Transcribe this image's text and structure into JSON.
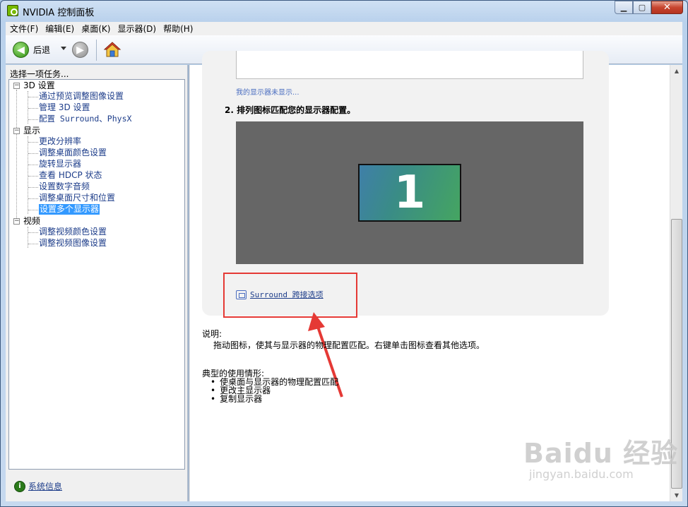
{
  "window": {
    "title": "NVIDIA 控制面板"
  },
  "menubar": [
    "文件(F)",
    "编辑(E)",
    "桌面(K)",
    "显示器(D)",
    "帮助(H)"
  ],
  "toolbar": {
    "back_label": "后退"
  },
  "left": {
    "header": "选择一项任务...",
    "tree": [
      {
        "label": "3D 设置",
        "children": [
          "通过预览调整图像设置",
          "管理 3D 设置",
          "配置 Surround、PhysX"
        ]
      },
      {
        "label": "显示",
        "children": [
          "更改分辨率",
          "调整桌面颜色设置",
          "旋转显示器",
          "查看 HDCP 状态",
          "设置数字音频",
          "调整桌面尺寸和位置",
          "设置多个显示器"
        ]
      },
      {
        "label": "视频",
        "children": [
          "调整视频颜色设置",
          "调整视频图像设置"
        ]
      }
    ],
    "selected": "设置多个显示器",
    "sysinfo": "系统信息"
  },
  "main": {
    "my_display_link": "我的显示器未显示...",
    "step_title": "2. 排列图标匹配您的显示器配置。",
    "monitor_number": "1",
    "surround_link": "Surround 跨接选项",
    "desc_label": "说明:",
    "desc_text": "拖动图标，使其与显示器的物理配置匹配。右键单击图标查看其他选项。",
    "usage_label": "典型的使用情形:",
    "usage_items": [
      "使桌面与显示器的物理配置匹配",
      "更改主显示器",
      "复制显示器"
    ]
  },
  "watermark": {
    "main": "Baidu 经验",
    "sub": "jingyan.baidu.com"
  }
}
